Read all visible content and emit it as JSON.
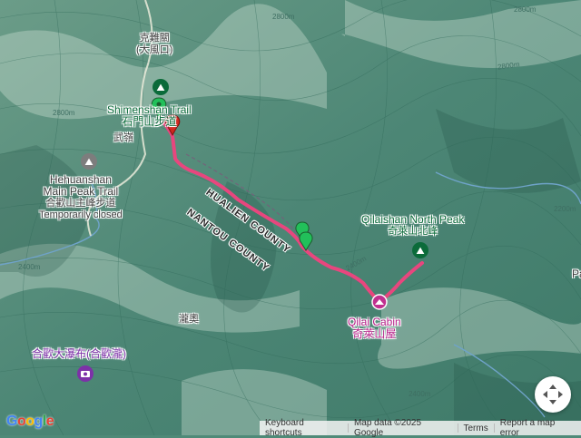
{
  "map": {
    "trail_labels": {
      "shimen_en": "Shimenshan Trail",
      "shimen_zh": "石門山步道",
      "kelai_zh_1": "克難關",
      "kelai_zh_2": "(大風口)",
      "wuling_zh": "武嶺",
      "hehuan_en_1": "Hehuanshan",
      "hehuan_en_2": "Main Peak Trail",
      "hehuan_zh": "合歡山主峰步道",
      "hehuan_status": "Temporarily closed",
      "north_peak_en": "Qilaishan North Peak",
      "north_peak_zh": "奇萊山北峰",
      "cabin_en": "Qilai Cabin",
      "cabin_zh": "奇萊山屋",
      "waterfall_zh": "合歡大瀑布(合歡瀧)",
      "place_zh": "瀧奧"
    },
    "county_labels": {
      "hualien": "HUALIEN COUNTY",
      "nantou": "NANTOU COUNTY"
    },
    "contour_labels": [
      "2800m",
      "2800m",
      "2400m",
      "2200m",
      "2400m",
      "2800m",
      "2400m",
      "2800m"
    ],
    "edge_label": "Pa",
    "colors": {
      "route": "#e8467e",
      "trail_green": "#0b6b3a",
      "cabin_pink": "#c0308f",
      "waterfall_purple": "#7d31a8",
      "start_marker": "#22c05a",
      "end_marker": "#d0261d"
    },
    "icons": [
      "hiking-marker-icon",
      "hiking-marker-icon",
      "hiking-marker-icon",
      "cabin-icon",
      "camera-icon",
      "locate-icon"
    ]
  },
  "footer": {
    "keyboard": "Keyboard shortcuts",
    "mapdata": "Map data ©2025 Google",
    "terms": "Terms",
    "report": "Report a map error",
    "logo": "Google"
  }
}
